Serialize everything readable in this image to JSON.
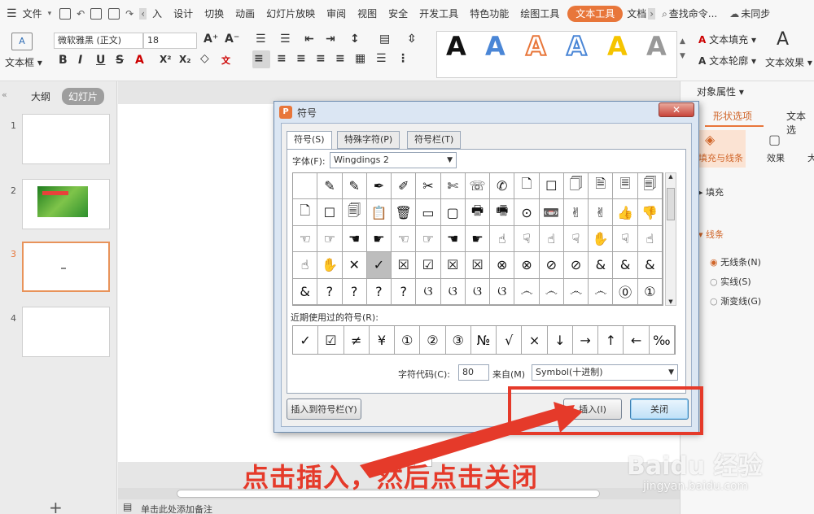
{
  "menubar": {
    "file_label": "文件",
    "tabs": [
      "入",
      "设计",
      "切换",
      "动画",
      "幻灯片放映",
      "审阅",
      "视图",
      "安全",
      "开发工具",
      "特色功能",
      "绘图工具",
      "文本工具",
      "文档"
    ],
    "active_tab": "文本工具",
    "search_label": "查找命令...",
    "sync_label": "未同步"
  },
  "toolbar": {
    "textbox_label": "文本框",
    "font_name": "微软雅黑 (正文)",
    "font_size": "18",
    "text_fill_label": "文本填充",
    "text_outline_label": "文本轮廓",
    "text_effect_label": "文本效果",
    "style_sample": "A"
  },
  "left_panel": {
    "tab_outline": "大纲",
    "tab_slides": "幻灯片",
    "slide_numbers": [
      "1",
      "2",
      "3",
      "4"
    ],
    "add_label": "+"
  },
  "right_panel": {
    "header": "对象属性",
    "tab_shape": "形状选项",
    "tab_text": "文本选",
    "sub_fill_line": "填充与线条",
    "sub_effect": "效果",
    "sub_size": "大",
    "fill_label": "填充",
    "line_label": "线条",
    "options": [
      "无线条(N)",
      "实线(S)",
      "渐变线(G)"
    ]
  },
  "notes_hint": "单击此处添加备注",
  "dialog": {
    "title": "符号",
    "close_label": "✕",
    "tabs": [
      "符号(S)",
      "特殊字符(P)",
      "符号栏(T)"
    ],
    "font_label": "字体(F):",
    "font_value": "Wingdings 2",
    "symbols": [
      "",
      "✎",
      "✎",
      "✒",
      "✐",
      "✂",
      "✄",
      "☏",
      "✆",
      "🗋",
      "☐",
      "🗍",
      "🗎",
      "🗏",
      "🗐",
      "🗋",
      "☐",
      "🗐",
      "📋",
      "🗑",
      "▭",
      "▢",
      "🖶",
      "🖷",
      "⊙",
      "📼",
      "✌",
      "✌",
      "👍",
      "👎",
      "☜",
      "☞",
      "☚",
      "☛",
      "☜",
      "☞",
      "☚",
      "☛",
      "☝",
      "☟",
      "☝",
      "☟",
      "✋",
      "☟",
      "☝",
      "☝",
      "✋",
      "✕",
      "✓",
      "☒",
      "☑",
      "☒",
      "☒",
      "⊗",
      "⊗",
      "⊘",
      "⊘",
      "&",
      "&",
      "&",
      "&",
      "?",
      "?",
      "?",
      "?",
      "ଓ",
      "ଓ",
      "ଓ",
      "ଓ",
      "෴",
      "෴",
      "෴",
      "෴",
      "⓪",
      "①"
    ],
    "selected_index": 48,
    "recent_label": "近期使用过的符号(R):",
    "recent": [
      "✓",
      "☑",
      "≠",
      "¥",
      "①",
      "②",
      "③",
      "№",
      "√",
      "×",
      "↓",
      "→",
      "↑",
      "←",
      "‰"
    ],
    "code_label": "字符代码(C):",
    "code_value": "80",
    "from_label": "来自(M)",
    "from_value": "Symbol(十进制)",
    "insert_to_bar_label": "插入到符号栏(Y)",
    "insert_label": "插入(I)",
    "close_button_label": "关闭"
  },
  "annotation": {
    "text": "点击插入，然后点击关闭",
    "color": "#e53a2a"
  },
  "watermark": {
    "main": "Baidu 经验",
    "sub": "jingyan.baidu.com"
  },
  "colors": {
    "accent": "#e8763a",
    "annotation_red": "#e53a2a",
    "dialog_frame": "#dbe6f3"
  }
}
